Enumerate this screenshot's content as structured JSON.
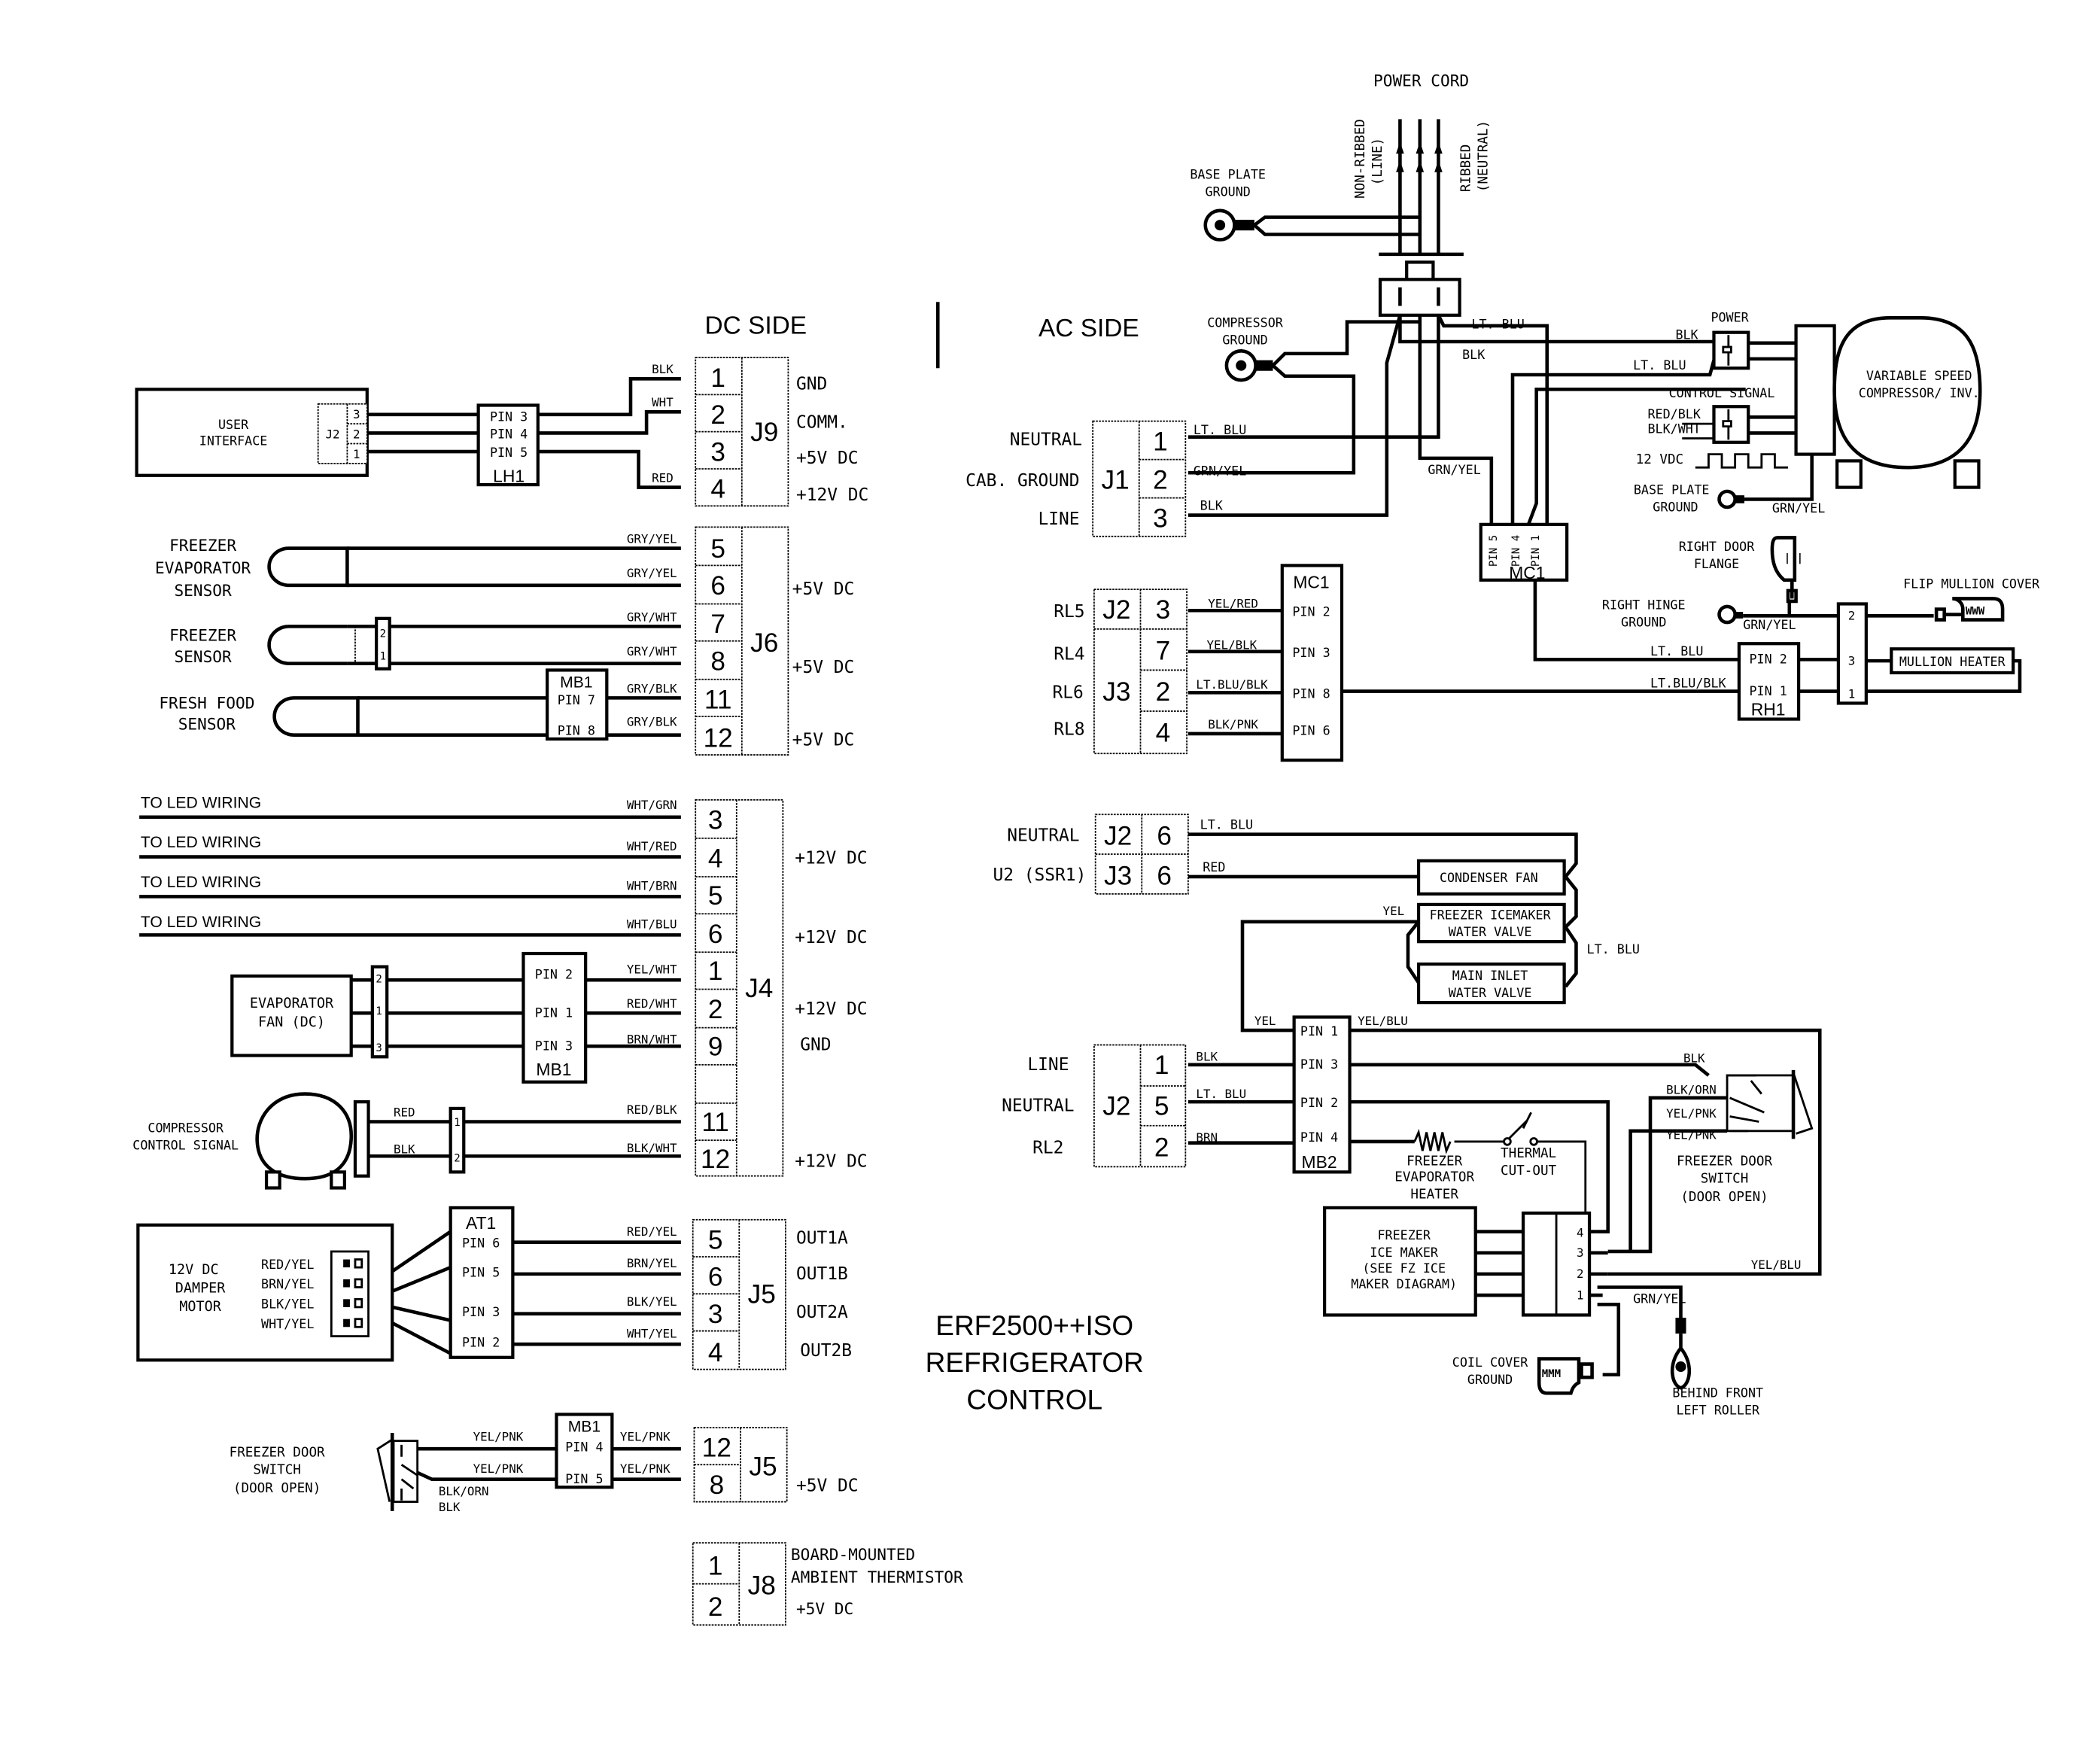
{
  "title": [
    "ERF2500++ISO",
    "REFRIGERATOR",
    "CONTROL"
  ],
  "sections": {
    "dc": "DC SIDE",
    "ac": "AC SIDE"
  },
  "power_cord": {
    "label": "POWER CORD",
    "line": [
      "NON-RIBBED",
      "(LINE)"
    ],
    "neutral": [
      "RIBBED",
      "(NEUTRAL)"
    ]
  },
  "dc": {
    "user_interface": {
      "label": [
        "USER",
        "INTERFACE"
      ],
      "conn": "J2",
      "pins": [
        "3",
        "2",
        "1"
      ]
    },
    "lh1": {
      "name": "LH1",
      "pins": [
        "PIN 3",
        "PIN 4",
        "PIN 5"
      ]
    },
    "j9": {
      "name": "J9",
      "pins": [
        "1",
        "2",
        "3",
        "4"
      ],
      "wires": [
        "BLK",
        "WHT",
        "",
        "RED"
      ],
      "labels": [
        "GND",
        "COMM.",
        "+5V DC",
        "+12V DC"
      ]
    },
    "j6": {
      "name": "J6",
      "pins": [
        "5",
        "6",
        "7",
        "8",
        "11",
        "12"
      ],
      "wires": [
        "GRY/YEL",
        "GRY/YEL",
        "GRY/WHT",
        "GRY/WHT",
        "GRY/BLK",
        "GRY/BLK"
      ],
      "labels": [
        "+5V DC",
        "+5V DC",
        "+5V DC"
      ]
    },
    "sensors": [
      {
        "label": [
          "FREEZER",
          "EVAPORATOR",
          "SENSOR"
        ]
      },
      {
        "label": [
          "FREEZER",
          "SENSOR"
        ],
        "conn_pins": [
          "2",
          "1"
        ]
      },
      {
        "label": [
          "FRESH FOOD",
          "SENSOR"
        ]
      }
    ],
    "mb1_sensor": {
      "name": "MB1",
      "pins": [
        "PIN 7",
        "PIN 8"
      ]
    },
    "j4": {
      "name": "J4",
      "pins": [
        "3",
        "4",
        "5",
        "6",
        "1",
        "2",
        "9",
        "",
        "11",
        "12"
      ],
      "wires": [
        "WHT/GRN",
        "WHT/RED",
        "WHT/BRN",
        "WHT/BLU",
        "YEL/WHT",
        "RED/WHT",
        "BRN/WHT",
        "",
        "RED/BLK",
        "BLK/WHT"
      ],
      "labels": [
        "+12V DC",
        "+12V DC",
        "+12V DC",
        "GND",
        "+12V DC"
      ]
    },
    "led_wiring": [
      "TO LED WIRING",
      "TO LED WIRING",
      "TO LED WIRING",
      "TO LED WIRING"
    ],
    "evap_fan": {
      "label": [
        "EVAPORATOR",
        "FAN (DC)"
      ],
      "conn_pins": [
        "2",
        "1",
        "3"
      ]
    },
    "mb1_fan": {
      "name": "MB1",
      "pins": [
        "PIN 2",
        "PIN 1",
        "PIN 3"
      ]
    },
    "comp_ctrl": {
      "label": [
        "COMPRESSOR",
        "CONTROL SIGNAL"
      ],
      "wires": [
        "RED",
        "BLK"
      ],
      "conn_pins": [
        "1",
        "2"
      ]
    },
    "damper": {
      "label": [
        "12V DC",
        "DAMPER",
        "MOTOR"
      ],
      "wires": [
        "RED/YEL",
        "BRN/YEL",
        "BLK/YEL",
        "WHT/YEL"
      ]
    },
    "at1": {
      "name": "AT1",
      "pins": [
        "PIN 6",
        "PIN 5",
        "PIN 3",
        "PIN 2"
      ]
    },
    "j5a": {
      "name": "J5",
      "pins": [
        "5",
        "6",
        "3",
        "4"
      ],
      "wires": [
        "RED/YEL",
        "BRN/YEL",
        "BLK/YEL",
        "WHT/YEL"
      ],
      "labels": [
        "OUT1A",
        "OUT1B",
        "OUT2A",
        "OUT2B"
      ]
    },
    "fz_door_switch": {
      "label": [
        "FREEZER DOOR",
        "SWITCH",
        "(DOOR OPEN)"
      ],
      "wires": [
        "YEL/PNK",
        "YEL/PNK",
        "BLK/ORN",
        "BLK"
      ]
    },
    "mb1_door": {
      "name": "MB1",
      "pins": [
        "PIN 4",
        "PIN 5"
      ],
      "wires": [
        "YEL/PNK",
        "YEL/PNK"
      ]
    },
    "j5b": {
      "name": "J5",
      "pins": [
        "12",
        "8"
      ],
      "labels": [
        "+5V DC"
      ]
    },
    "j8": {
      "name": "J8",
      "pins": [
        "1",
        "2"
      ],
      "labels": [
        "BOARD-MOUNTED",
        "AMBIENT THERMISTOR",
        "+5V DC"
      ]
    }
  },
  "ac": {
    "base_plate_ground_top": [
      "BASE PLATE",
      "GROUND"
    ],
    "compressor_ground": [
      "COMPRESSOR",
      "GROUND"
    ],
    "j1": {
      "name": "J1",
      "pins": [
        "1",
        "2",
        "3"
      ],
      "signals": [
        "NEUTRAL",
        "CAB. GROUND",
        "LINE"
      ],
      "wires": [
        "LT. BLU",
        "GRN/YEL",
        "BLK"
      ]
    },
    "cord_wires": [
      "LT. BLU",
      "BLK",
      "GRN/YEL"
    ],
    "mc1_top": {
      "name": "MC1",
      "pins": [
        "PIN 5",
        "PIN 4",
        "PIN 1"
      ]
    },
    "compressor": {
      "label": [
        "VARIABLE SPEED",
        "COMPRESSOR/ INV."
      ],
      "power": "POWER",
      "power_wires": [
        "BLK",
        "LT. BLU"
      ],
      "control": "CONTROL SIGNAL",
      "control_wires": [
        "RED/BLK",
        "BLK/WHT"
      ],
      "pwm": "12 VDC",
      "ground": [
        "BASE PLATE",
        "GROUND"
      ],
      "ground_wire": "GRN/YEL"
    },
    "relays": {
      "signals": [
        "RL5",
        "RL4",
        "RL6",
        "RL8"
      ],
      "conns": [
        "J2",
        "J3"
      ],
      "pins": [
        "3",
        "7",
        "2",
        "4"
      ],
      "wires": [
        "YEL/RED",
        "YEL/BLK",
        "LT.BLU/BLK",
        "BLK/PNK"
      ]
    },
    "mc1_box": {
      "name": "MC1",
      "pins": [
        "PIN 2",
        "PIN 3",
        "PIN 8",
        "PIN 6"
      ]
    },
    "right_door_flange": [
      "RIGHT DOOR",
      "FLANGE"
    ],
    "right_hinge_ground": [
      "RIGHT HINGE",
      "GROUND"
    ],
    "flip_mullion": "FLIP MULLION COVER",
    "mullion_wires": [
      "GRN/YEL",
      "LT. BLU",
      "LT.BLU/BLK"
    ],
    "rh1": {
      "name": "RH1",
      "pins": [
        "PIN 2",
        "PIN 1"
      ]
    },
    "mullion_conn_pins": [
      "2",
      "3",
      "1"
    ],
    "mullion_heater": "MULLION HEATER",
    "cond": {
      "signals": [
        "NEUTRAL",
        "U2 (SSR1)"
      ],
      "conns": [
        "J2",
        "J3"
      ],
      "pins": [
        "6",
        "6"
      ],
      "wires": [
        "LT. BLU",
        "RED"
      ]
    },
    "condenser_fan": "CONDENSER FAN",
    "icemaker_valve": [
      "FREEZER ICEMAKER",
      "WATER VALVE"
    ],
    "inlet_valve": [
      "MAIN INLET",
      "WATER VALVE"
    ],
    "valve_wires": [
      "YEL",
      "LT. BLU",
      "YEL",
      "YEL/BLU"
    ],
    "j2b": {
      "name": "J2",
      "pins": [
        "1",
        "5",
        "2"
      ],
      "signals": [
        "LINE",
        "NEUTRAL",
        "RL2"
      ],
      "wires": [
        "BLK",
        "LT. BLU",
        "BRN"
      ]
    },
    "mb2": {
      "name": "MB2",
      "pins": [
        "PIN 1",
        "PIN 3",
        "PIN 2",
        "PIN 4"
      ]
    },
    "evap_heater": [
      "FREEZER",
      "EVAPORATOR",
      "HEATER"
    ],
    "thermal_cutout": [
      "THERMAL",
      "CUT-OUT"
    ],
    "fz_door_switch": {
      "label": [
        "FREEZER DOOR",
        "SWITCH",
        "(DOOR OPEN)"
      ],
      "wires": [
        "BLK",
        "BLK/ORN",
        "YEL/PNK",
        "YEL/PNK"
      ]
    },
    "ice_maker": [
      "FREEZER",
      "ICE MAKER",
      "(SEE FZ ICE",
      "MAKER DIAGRAM)"
    ],
    "ice_conn_pins": [
      "4",
      "3",
      "2",
      "1"
    ],
    "yel_blu": "YEL/BLU",
    "grn_yel": "GRN/YEL",
    "coil_cover_ground": [
      "COIL COVER",
      "GROUND"
    ],
    "roller_ground": [
      "BEHIND FRONT",
      "LEFT ROLLER"
    ]
  }
}
